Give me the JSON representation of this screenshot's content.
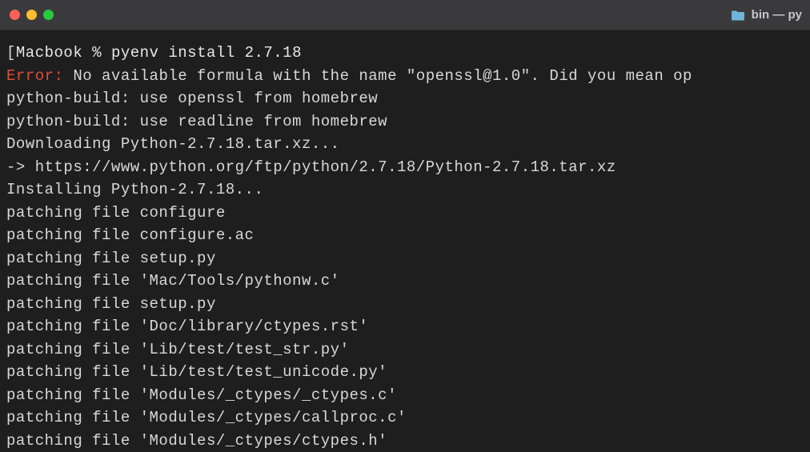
{
  "titlebar": {
    "title": "bin — py",
    "folder_icon": "folder-icon"
  },
  "prompt": {
    "host": "Macbook",
    "symbol": "%",
    "command": "pyenv install 2.7.18"
  },
  "error": {
    "label": "Error:",
    "message": " No available formula with the name \"openssl@1.0\". Did you mean op"
  },
  "output": [
    "python-build: use openssl from homebrew",
    "python-build: use readline from homebrew",
    "Downloading Python-2.7.18.tar.xz...",
    "-> https://www.python.org/ftp/python/2.7.18/Python-2.7.18.tar.xz",
    "Installing Python-2.7.18...",
    "patching file configure",
    "patching file configure.ac",
    "patching file setup.py",
    "patching file 'Mac/Tools/pythonw.c'",
    "patching file setup.py",
    "patching file 'Doc/library/ctypes.rst'",
    "patching file 'Lib/test/test_str.py'",
    "patching file 'Lib/test/test_unicode.py'",
    "patching file 'Modules/_ctypes/_ctypes.c'",
    "patching file 'Modules/_ctypes/callproc.c'",
    "patching file 'Modules/_ctypes/ctypes.h'"
  ]
}
